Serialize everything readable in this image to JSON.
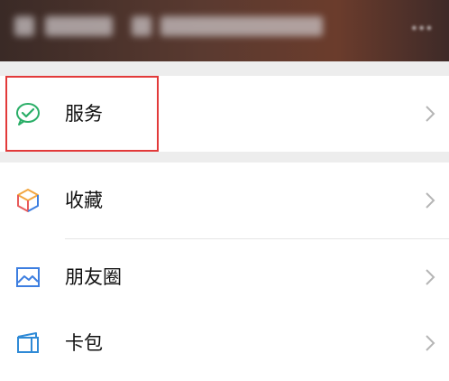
{
  "header": {
    "profile_text": "",
    "status_text": ""
  },
  "menu": {
    "items": [
      {
        "label": "服务",
        "icon": "wechat-pay-icon",
        "color": "#2aae67"
      },
      {
        "label": "收藏",
        "icon": "favorites-cube-icon",
        "color": "#f2a640"
      },
      {
        "label": "朋友圈",
        "icon": "moments-photo-icon",
        "color": "#3d7ee0"
      },
      {
        "label": "卡包",
        "icon": "card-wallet-icon",
        "color": "#2f8ad6"
      }
    ]
  },
  "highlight_color": "#e23a3a"
}
